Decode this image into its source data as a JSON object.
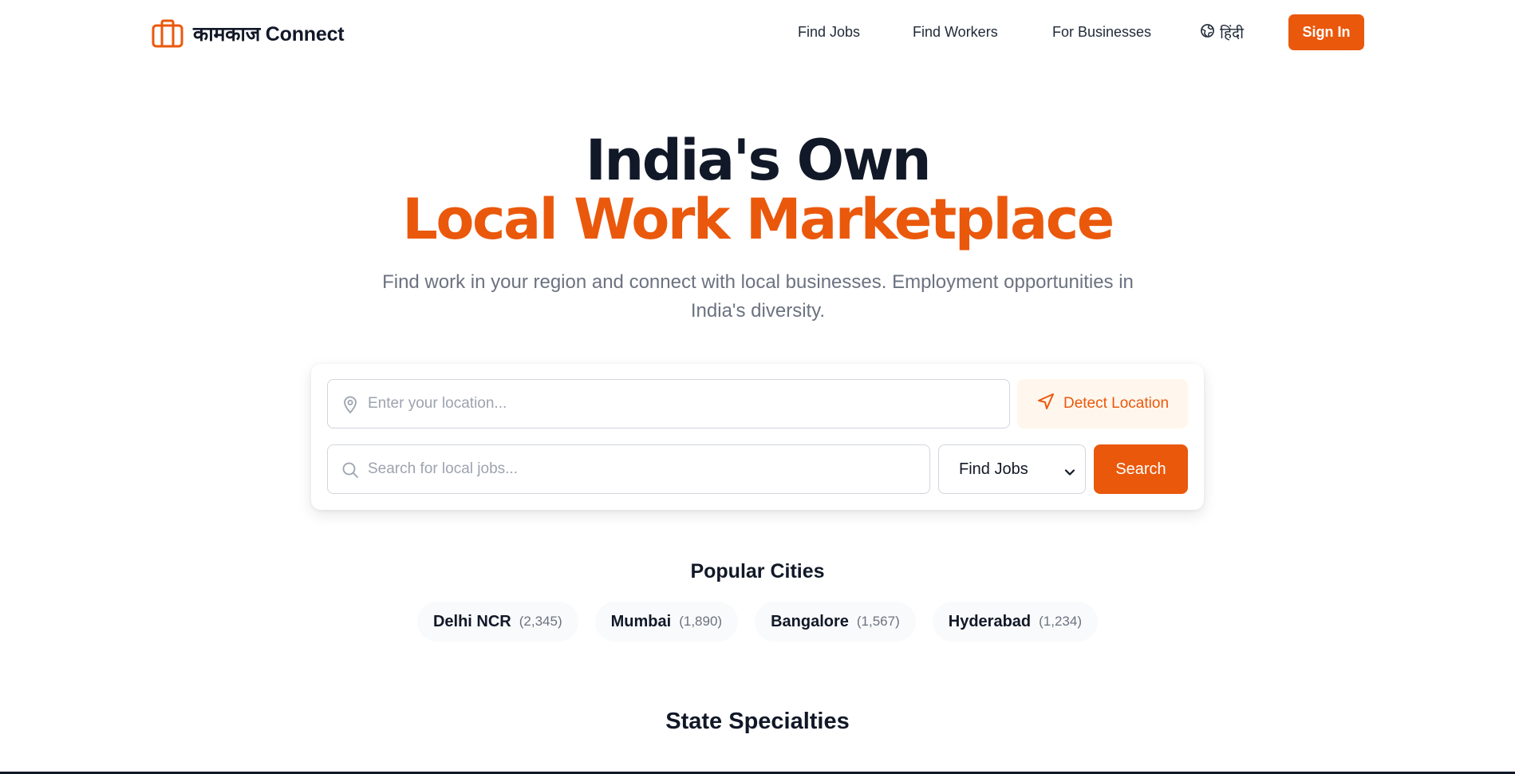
{
  "header": {
    "brand": "कामकाज Connect",
    "nav": [
      "Find Jobs",
      "Find Workers",
      "For Businesses"
    ],
    "language": "हिंदी",
    "signin_label": "Sign In"
  },
  "hero": {
    "title_line1": "India's Own",
    "title_line2": "Local Work Marketplace",
    "subtitle": "Find work in your region and connect with local businesses. Employment opportunities in India's diversity."
  },
  "search": {
    "location_placeholder": "Enter your location...",
    "detect_label": "Detect Location",
    "jobs_placeholder": "Search for local jobs...",
    "mode_selected": "Find Jobs",
    "search_label": "Search"
  },
  "popular": {
    "title": "Popular Cities",
    "cities": [
      {
        "name": "Delhi NCR",
        "count": "(2,345)"
      },
      {
        "name": "Mumbai",
        "count": "(1,890)"
      },
      {
        "name": "Bangalore",
        "count": "(1,567)"
      },
      {
        "name": "Hyderabad",
        "count": "(1,234)"
      }
    ]
  },
  "state_specialties": {
    "title": "State Specialties"
  },
  "colors": {
    "accent": "#ea580c",
    "accent_light": "#fff7ed",
    "text_dark": "#111827",
    "text_muted": "#6b7280"
  },
  "icons": {
    "brand": "briefcase-icon",
    "language": "globe-icon",
    "location": "map-pin-icon",
    "detect": "navigation-arrow-icon",
    "search": "search-icon",
    "select": "chevron-down-icon"
  }
}
